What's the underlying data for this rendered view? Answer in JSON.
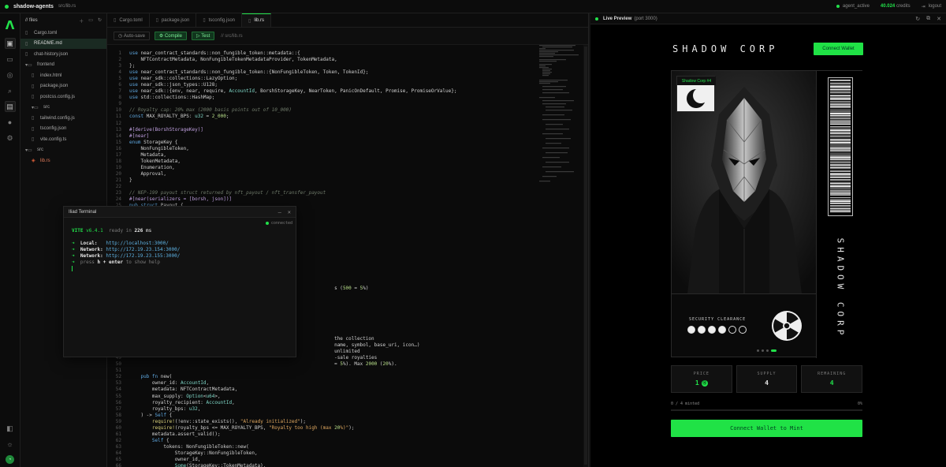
{
  "topbar": {
    "brand": "shadow-agents",
    "path": "src/lib.rs",
    "status": "agent_active",
    "credits_value": "40.024",
    "credits_label": "credits",
    "logout": "logout"
  },
  "rail": {
    "logo": "Λ"
  },
  "files": {
    "header": "// files",
    "items": [
      {
        "name": "Cargo.toml",
        "depth": 0,
        "kind": "file"
      },
      {
        "name": "README.md",
        "depth": 0,
        "kind": "file",
        "selected": true
      },
      {
        "name": "chat-history.json",
        "depth": 0,
        "kind": "file"
      },
      {
        "name": "frontend",
        "depth": 0,
        "kind": "folder"
      },
      {
        "name": "index.html",
        "depth": 1,
        "kind": "file"
      },
      {
        "name": "package.json",
        "depth": 1,
        "kind": "file"
      },
      {
        "name": "postcss.config.js",
        "depth": 1,
        "kind": "file"
      },
      {
        "name": "src",
        "depth": 1,
        "kind": "folder"
      },
      {
        "name": "tailwind.config.js",
        "depth": 1,
        "kind": "file"
      },
      {
        "name": "tsconfig.json",
        "depth": 1,
        "kind": "file"
      },
      {
        "name": "vite.config.ts",
        "depth": 1,
        "kind": "file"
      },
      {
        "name": "src",
        "depth": 0,
        "kind": "folder"
      },
      {
        "name": "lib.rs",
        "depth": 1,
        "kind": "rs"
      }
    ]
  },
  "tabs": [
    {
      "label": "Cargo.toml",
      "active": false
    },
    {
      "label": "package.json",
      "active": false
    },
    {
      "label": "tsconfig.json",
      "active": false
    },
    {
      "label": "lib.rs",
      "active": true
    }
  ],
  "toolbar": {
    "autosave": "Auto-save",
    "compile": "Compile",
    "test": "Test",
    "path": "// src/lib.rs"
  },
  "code": [
    "use near_contract_standards::non_fungible_token::metadata::{",
    "    NFTContractMetadata, NonFungibleTokenMetadataProvider, TokenMetadata,",
    "};",
    "use near_contract_standards::non_fungible_token::{NonFungibleToken, Token, TokenId};",
    "use near_sdk::collections::LazyOption;",
    "use near_sdk::json_types::U128;",
    "use near_sdk::{env, near, require, AccountId, BorshStorageKey, NearToken, PanicOnDefault, Promise, PromiseOrValue};",
    "use std::collections::HashMap;",
    "",
    "// Royalty cap: 20% max (2000 basis points out of 10_000)",
    "const MAX_ROYALTY_BPS: u32 = 2_000;",
    "",
    "#[derive(BorshStorageKey)]",
    "#[near]",
    "enum StorageKey {",
    "    NonFungibleToken,",
    "    Metadata,",
    "    TokenMetadata,",
    "    Enumeration,",
    "    Approval,",
    "}",
    "",
    "// NEP-199 payout struct returned by nft_payout / nft_transfer_payout",
    "#[near(serializers = [borsh, json])]",
    "pub struct Payout {",
    "",
    "",
    "",
    "",
    "",
    "",
    "",
    "",
    "",
    "",
    "",
    "",
    "                                                                        s (500 = 5%)",
    "",
    "",
    "",
    "",
    "",
    "",
    "",
    "                                                                        the collection",
    "                                                                        name, symbol, base_uri, icon…)",
    "                                                                        unlimited",
    "                                                                        -sale royalties",
    "                                                                        = 5%). Max 2000 (20%).",
    "",
    "    pub fn new(",
    "        owner_id: AccountId,",
    "        metadata: NFTContractMetadata,",
    "        max_supply: Option<u64>,",
    "        royalty_recipient: AccountId,",
    "        royalty_bps: u32,",
    "    ) -> Self {",
    "        require!(!env::state_exists(), \"Already initialized\");",
    "        require!(royalty_bps <= MAX_ROYALTY_BPS, \"Royalty too high (max 20%)\");",
    "        metadata.assert_valid();",
    "        Self {",
    "            tokens: NonFungibleToken::new(",
    "                StorageKey::NonFungibleToken,",
    "                owner_id,",
    "                Some(StorageKey::TokenMetadata),",
    "                Some(StorageKey::Enumeration),",
    "                Some(StorageKey::Approval),",
    "            ),"
  ],
  "terminal": {
    "title": "Iliad Terminal",
    "status": "connected",
    "vite_name": "VITE",
    "vite_version": "v6.4.1",
    "ready_text": "ready in",
    "ready_ms": "226",
    "ready_unit": "ms",
    "local_label": "Local:",
    "local_url": "http://localhost:3000/",
    "net_label": "Network:",
    "net_url1": "http://172.19.23.154:3000/",
    "net_url2": "http://172.19.23.155:3000/",
    "help_press": "press",
    "help_keys": "h + enter",
    "help_rest": "to show help"
  },
  "preview": {
    "title": "Live Preview",
    "port": "(port 3000)",
    "corp_title": "SHADOW CORP",
    "connect_wallet": "Connect Wallet",
    "badge_label": "Shadow Corp #4",
    "clearance_label": "SECURITY CLEARANCE",
    "clearance_level": 4,
    "clearance_max": 6,
    "vertical_text": "SHADOW CORP",
    "page_count": 4,
    "page_active": 3,
    "price_label": "PRICE",
    "price_value": "1",
    "supply_label": "SUPPLY",
    "supply_value": "4",
    "remaining_label": "REMAINING",
    "remaining_value": "4",
    "minted_text": "0 / 4 minted",
    "minted_pct": "0%",
    "minted_fraction": 0,
    "mint_button": "Connect Wallet to Mint"
  },
  "colors": {
    "accent": "#22e04a",
    "bg": "#0b0b0b"
  }
}
